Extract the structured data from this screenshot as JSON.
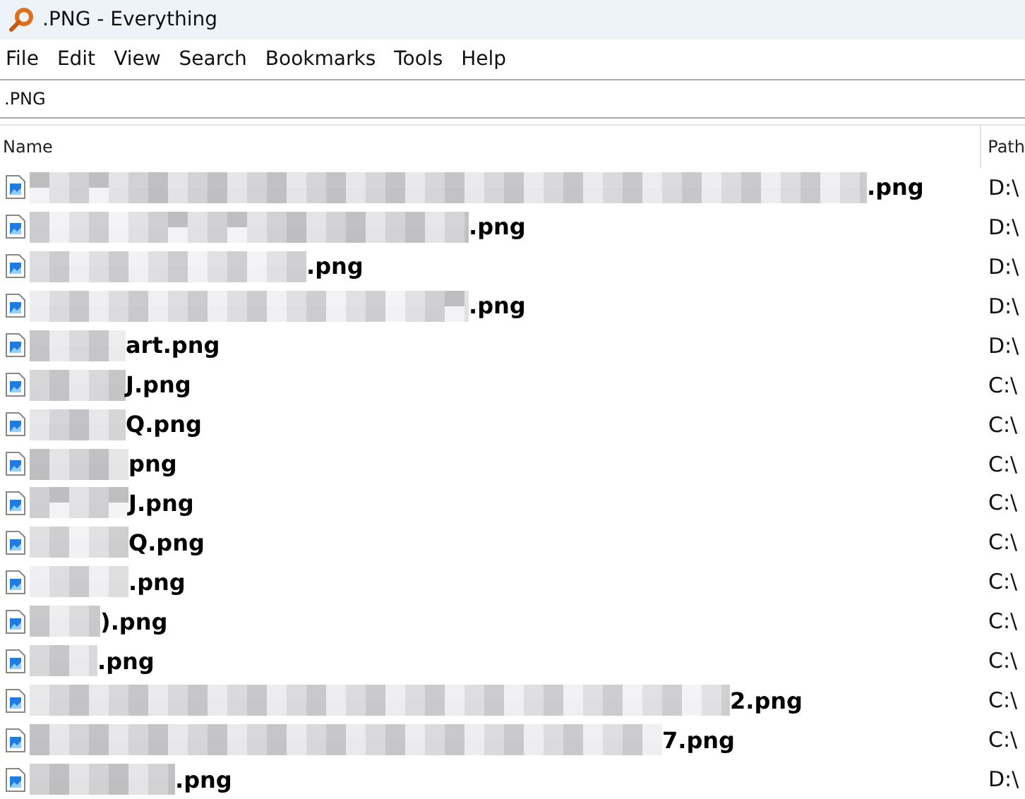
{
  "window": {
    "title": ".PNG - Everything"
  },
  "menu": [
    "File",
    "Edit",
    "View",
    "Search",
    "Bookmarks",
    "Tools",
    "Help"
  ],
  "search": {
    "value": ".PNG"
  },
  "columns": [
    "Name",
    "Path"
  ],
  "rows": [
    {
      "name": ".png",
      "path": "D:\\"
    },
    {
      "name": ".png",
      "path": "D:\\"
    },
    {
      "name": ".png",
      "path": "D:\\"
    },
    {
      "name": ".png",
      "path": "D:\\"
    },
    {
      "name": "art.png",
      "path": "D:\\"
    },
    {
      "name": "J.png",
      "path": "C:\\"
    },
    {
      "name": "Q.png",
      "path": "C:\\"
    },
    {
      "name": "png",
      "path": "C:\\"
    },
    {
      "name": "J.png",
      "path": "C:\\"
    },
    {
      "name": "Q.png",
      "path": "C:\\"
    },
    {
      "name": ".png",
      "path": "C:\\"
    },
    {
      "name": ").png",
      "path": "C:\\"
    },
    {
      "name": ".png",
      "path": "C:\\"
    },
    {
      "name": "2.png",
      "path": "C:\\"
    },
    {
      "name": "7.png",
      "path": "C:\\"
    },
    {
      "name": ".png",
      "path": "D:\\"
    }
  ]
}
